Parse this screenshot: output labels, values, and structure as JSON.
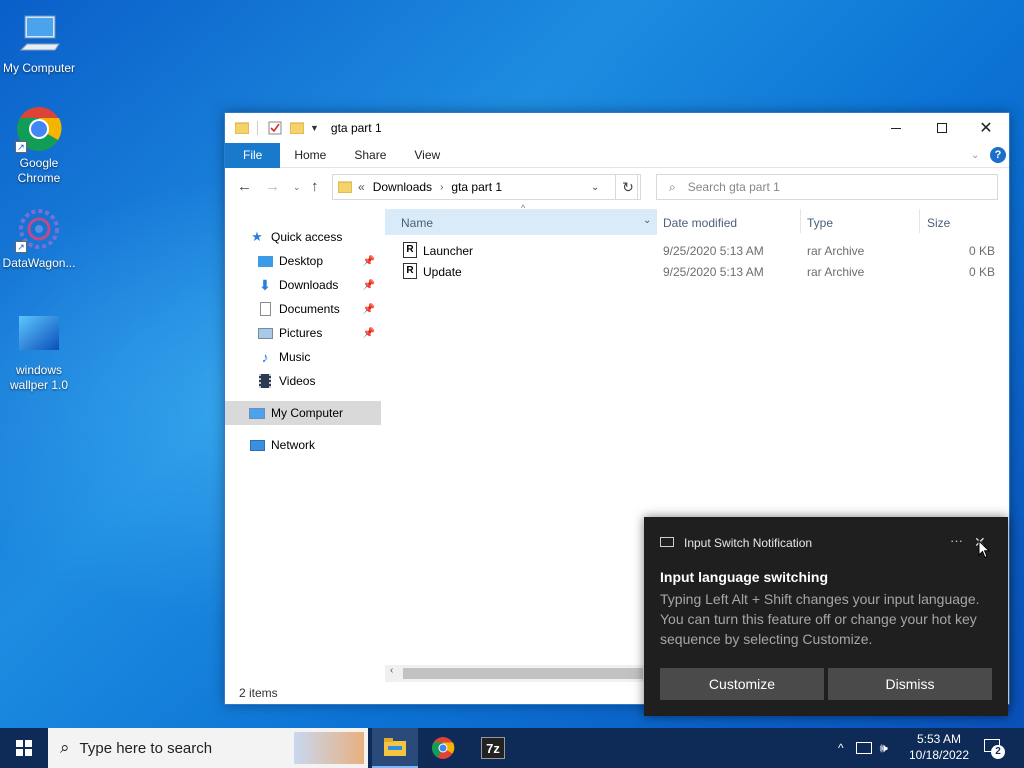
{
  "desktop": {
    "icons": [
      {
        "label": "My Computer"
      },
      {
        "label": "Google Chrome"
      },
      {
        "label": "DataWagon..."
      },
      {
        "label": "windows wallper 1.0"
      }
    ]
  },
  "explorer": {
    "title": "gta part 1",
    "ribbon_tabs": [
      "File",
      "Home",
      "Share",
      "View"
    ],
    "address": {
      "prefix": "«",
      "crumbs": [
        "Downloads",
        "gta part 1"
      ]
    },
    "search_placeholder": "Search gta part 1",
    "nav": [
      {
        "label": "Quick access",
        "icon": "star-icon"
      },
      {
        "label": "Desktop",
        "icon": "desktop-folder-icon",
        "pinned": true
      },
      {
        "label": "Downloads",
        "icon": "download-arrow-icon",
        "pinned": true
      },
      {
        "label": "Documents",
        "icon": "document-icon",
        "pinned": true
      },
      {
        "label": "Pictures",
        "icon": "picture-icon",
        "pinned": true
      },
      {
        "label": "Music",
        "icon": "music-note-icon"
      },
      {
        "label": "Videos",
        "icon": "video-icon"
      },
      {
        "label": "My Computer",
        "icon": "computer-icon"
      },
      {
        "label": "Network",
        "icon": "network-icon"
      }
    ],
    "columns": [
      "Name",
      "Date modified",
      "Type",
      "Size"
    ],
    "files": [
      {
        "name": "Launcher",
        "date": "9/25/2020 5:13 AM",
        "type": "rar Archive",
        "size": "0 KB"
      },
      {
        "name": "Update",
        "date": "9/25/2020 5:13 AM",
        "type": "rar Archive",
        "size": "0 KB"
      }
    ],
    "status": "2 items"
  },
  "notification": {
    "app": "Input Switch Notification",
    "title": "Input language switching",
    "body": "Typing Left Alt + Shift changes your input language. You can turn this feature off or change your hot key sequence by selecting Customize.",
    "more": "···",
    "buttons": [
      "Customize",
      "Dismiss"
    ]
  },
  "taskbar": {
    "search_placeholder": "Type here to search",
    "time": "5:53 AM",
    "date": "10/18/2022",
    "notif_count": "2",
    "sevenzip_label": "7z"
  },
  "colors": {
    "accent": "#1979ca",
    "taskbar": "#0e2a56",
    "toast": "#1f1f1f"
  }
}
